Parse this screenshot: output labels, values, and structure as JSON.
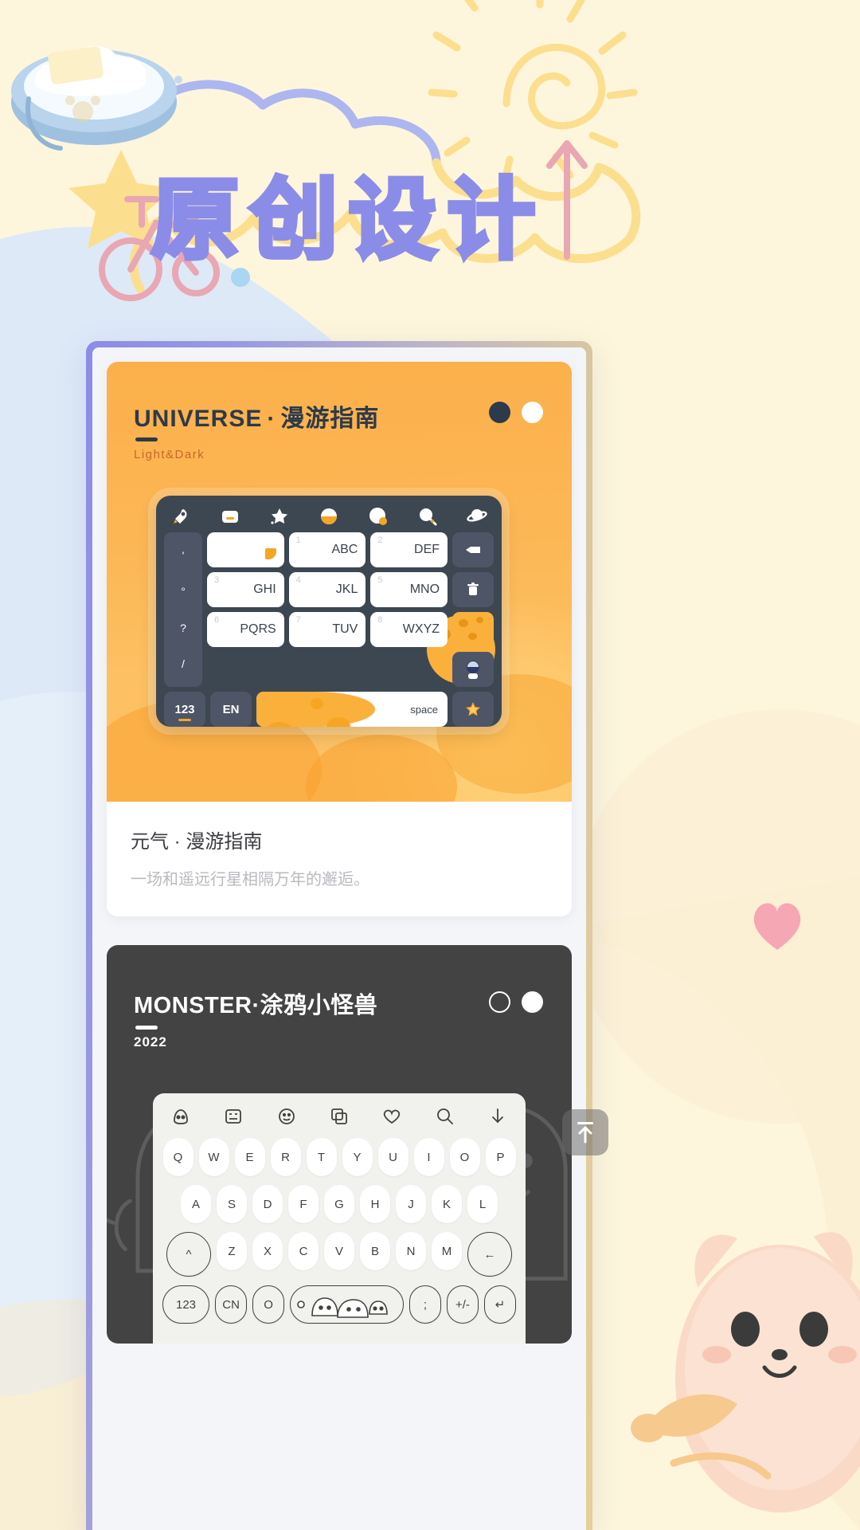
{
  "page": {
    "headline": "原创设计",
    "bg_color": "#FDF6DC",
    "accent_purple": "#8B8CE8",
    "accent_orange": "#FBB03B"
  },
  "decor": {
    "sun_icon": "sun-doodle-icon",
    "cloud_icon": "cloud-doodle-icon",
    "bike_icon": "bicycle-doodle-icon",
    "bowl_icon": "bowl-illustration",
    "star_icon": "star-doodle-icon",
    "arrow_icon": "arrow-up-doodle-icon",
    "heart_icon": "heart-icon",
    "mascot_icon": "cat-mascot-illustration"
  },
  "phone": {
    "cards": [
      {
        "id": "universe",
        "theme": "light",
        "title_en": "UNIVERSE",
        "separator": "·",
        "title_cn": "漫游指南",
        "subtitle": "Light&Dark",
        "toggle": [
          "dark",
          "light"
        ],
        "caption_title": "元气 · 漫游指南",
        "caption_desc": "一场和遥远行星相隔万年的邂逅。",
        "keyboard": {
          "type": "t9",
          "toolbar_icons": [
            "rocket-icon",
            "keyboard-icon",
            "star-icon",
            "moon-icon",
            "moon-phase-icon",
            "search-icon",
            "planet-icon"
          ],
          "punct_column": [
            "'",
            "°",
            "?",
            "/"
          ],
          "keys": [
            {
              "num": "",
              "label": ""
            },
            {
              "num": "1",
              "label": "ABC"
            },
            {
              "num": "2",
              "label": "DEF"
            },
            {
              "num": "3",
              "label": "GHI"
            },
            {
              "num": "4",
              "label": "JKL"
            },
            {
              "num": "5",
              "label": "MNO"
            },
            {
              "num": "6",
              "label": "PQRS"
            },
            {
              "num": "7",
              "label": "TUV"
            },
            {
              "num": "8",
              "label": "WXYZ"
            }
          ],
          "fn_column": [
            "backspace-icon",
            "trash-icon",
            "cheese-moon-icon",
            "astronaut-icon"
          ],
          "bottom_row": {
            "numeric": "123",
            "language": "EN",
            "space": "space",
            "sticker": "star-icon"
          }
        }
      },
      {
        "id": "monster",
        "theme": "dark",
        "title_en": "MONSTER",
        "separator": "·",
        "title_cn": "涂鸦小怪兽",
        "subtitle": "2022",
        "toggle": [
          "ring",
          "light"
        ],
        "keyboard": {
          "type": "qwerty",
          "toolbar_icons": [
            "monster-face-icon",
            "sticker-icon",
            "emoji-icon",
            "clipboard-icon",
            "heart-icon",
            "search-icon",
            "download-icon"
          ],
          "row1": [
            "Q",
            "W",
            "E",
            "R",
            "T",
            "Y",
            "U",
            "I",
            "O",
            "P"
          ],
          "row2": [
            "A",
            "S",
            "D",
            "F",
            "G",
            "H",
            "J",
            "K",
            "L"
          ],
          "row3_shift": "^",
          "row3": [
            "Z",
            "X",
            "C",
            "V",
            "B",
            "N",
            "M"
          ],
          "row3_backspace": "←",
          "bottom_row": {
            "numeric": "123",
            "language": "CN",
            "circle": "O",
            "space": "doodle-monsters",
            "semicolon": ";",
            "plusminus": "+/-",
            "enter": "↵"
          }
        }
      }
    ]
  },
  "fab": {
    "label": "back-to-top",
    "icon": "arrow-up-bar-icon"
  }
}
